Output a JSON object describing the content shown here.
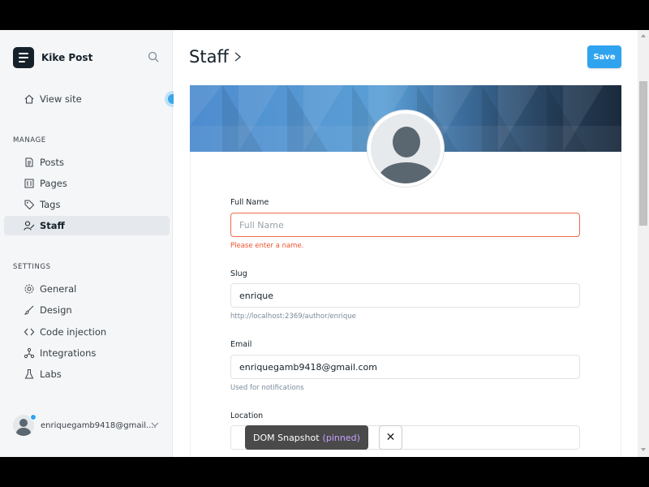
{
  "sidebar": {
    "site_title": "Kike Post",
    "view_site": "View site",
    "manage_title": "MANAGE",
    "manage_items": [
      {
        "label": "Posts",
        "icon": "posts-icon"
      },
      {
        "label": "Pages",
        "icon": "pages-icon"
      },
      {
        "label": "Tags",
        "icon": "tag-icon"
      },
      {
        "label": "Staff",
        "icon": "staff-icon",
        "active": true
      }
    ],
    "settings_title": "SETTINGS",
    "settings_items": [
      {
        "label": "General",
        "icon": "gear-icon"
      },
      {
        "label": "Design",
        "icon": "brush-icon"
      },
      {
        "label": "Code injection",
        "icon": "code-icon"
      },
      {
        "label": "Integrations",
        "icon": "integrations-icon"
      },
      {
        "label": "Labs",
        "icon": "flask-icon"
      }
    ],
    "user_email": "enriquegamb9418@gmail...."
  },
  "header": {
    "title": "Staff",
    "save_label": "Save"
  },
  "form": {
    "full_name": {
      "label": "Full Name",
      "placeholder": "Full Name",
      "value": "",
      "error": "Please enter a name."
    },
    "slug": {
      "label": "Slug",
      "value": "enrique",
      "hint": "http://localhost:2369/author/enrique"
    },
    "email": {
      "label": "Email",
      "value": "enriquegamb9418@gmail.com",
      "hint": "Used for notifications"
    },
    "location": {
      "label": "Location",
      "value": ""
    }
  },
  "overlay": {
    "snapshot_label": "DOM Snapshot",
    "snapshot_state": "(pinned)",
    "close_symbol": "✕"
  },
  "colors": {
    "accent": "#30a3ef",
    "error": "#f05230",
    "sidebar_bg": "#f5f6f8",
    "cover_blue": "#4a88c6"
  }
}
